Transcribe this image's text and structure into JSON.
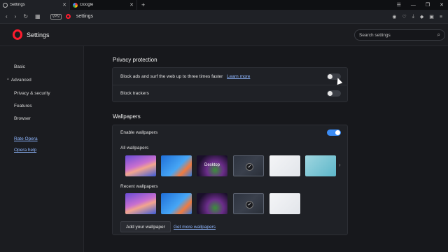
{
  "tabs": [
    {
      "label": "Settings",
      "active": true
    },
    {
      "label": "Google",
      "active": false
    }
  ],
  "address": {
    "vpn_label": "VPN",
    "url": "settings"
  },
  "header": {
    "title": "Settings",
    "search_placeholder": "Search settings"
  },
  "sidebar": {
    "basic": "Basic",
    "advanced": "Advanced",
    "items": [
      "Privacy & security",
      "Features",
      "Browser"
    ],
    "links": [
      "Rate Opera",
      "Opera help"
    ]
  },
  "privacy": {
    "title": "Privacy protection",
    "block_ads": "Block ads and surf the web up to three times faster",
    "learn_more": "Learn more",
    "block_ads_enabled": false,
    "block_trackers": "Block trackers",
    "block_trackers_enabled": false
  },
  "wallpapers": {
    "title": "Wallpapers",
    "enable_label": "Enable wallpapers",
    "enabled": true,
    "all_label": "All wallpapers",
    "recent_label": "Recent wallpapers",
    "desktop_label": "Desktop",
    "add_button": "Add your wallpaper",
    "more_link": "Get more wallpapers"
  },
  "colors": {
    "accent": "#3b8cf5",
    "brand": "#ff1b2d",
    "link": "#8fb7ff"
  }
}
